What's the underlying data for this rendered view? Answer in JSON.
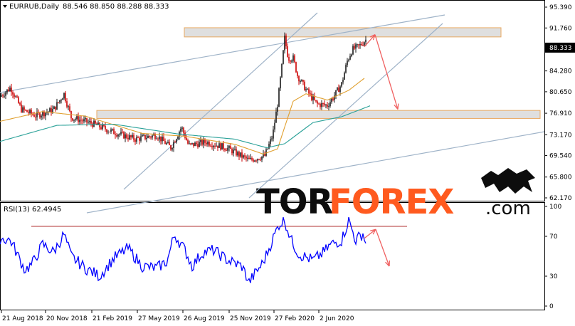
{
  "header": {
    "title": "EURRUB,Daily",
    "values": "88.546 88.850 88.288 88.333"
  },
  "rsi_header": {
    "label": "RSI(13) 62.4945"
  },
  "watermark": {
    "brand_left": "TOR",
    "brand_right": "FOREX",
    "domain": ".com"
  },
  "colors": {
    "candle_up": "#1a1a1a",
    "candle_down": "#cc0000",
    "ma_fast": "#e0a030",
    "ma_slow": "#2aa198",
    "channel": "#9fb3c8",
    "zone_fill": "#d9d9d9",
    "zone_border": "#e8a860",
    "arrow": "#f06060",
    "rsi_line": "#0000ff",
    "rsi_level": "#b03030",
    "brand_accent": "#ff5a1f"
  },
  "chart_data": [
    {
      "type": "candlestick",
      "title": "EURRUB,Daily",
      "y_ticks": [
        "95.390",
        "91.760",
        "88.333",
        "84.280",
        "80.650",
        "76.910",
        "73.170",
        "69.540",
        "65.800",
        "62.170"
      ],
      "ylim": [
        62.17,
        95.39
      ],
      "current_price": "88.333",
      "x_ticks": [
        "21 Aug 2018",
        "20 Nov 2018",
        "21 Feb 2019",
        "27 May 2019",
        "26 Aug 2019",
        "25 Nov 2019",
        "27 Feb 2020",
        "2 Jun 2020"
      ],
      "series": [
        {
          "name": "",
          "style": "candles",
          "anchors": [
            [
              0,
              79.8
            ],
            [
              15,
              81.4
            ],
            [
              30,
              77.6
            ],
            [
              50,
              76.5
            ],
            [
              75,
              77.5
            ],
            [
              90,
              80.3
            ],
            [
              100,
              76.2
            ],
            [
              130,
              75.1
            ],
            [
              160,
              73.6
            ],
            [
              190,
              72.4
            ],
            [
              220,
              73.1
            ],
            [
              240,
              70.9
            ],
            [
              255,
              74.5
            ],
            [
              265,
              71.3
            ],
            [
              290,
              71.9
            ],
            [
              320,
              70.8
            ],
            [
              350,
              68.7
            ],
            [
              372,
              69.5
            ],
            [
              383,
              73.0
            ],
            [
              390,
              78.5
            ],
            [
              396,
              85.0
            ],
            [
              400,
              90.0
            ],
            [
              405,
              86.5
            ],
            [
              412,
              86.5
            ],
            [
              418,
              83.5
            ],
            [
              430,
              81.0
            ],
            [
              445,
              78.5
            ],
            [
              460,
              78.3
            ],
            [
              470,
              80.0
            ],
            [
              480,
              82.0
            ],
            [
              488,
              86.0
            ],
            [
              495,
              88.0
            ],
            [
              505,
              88.6
            ],
            [
              514,
              89.7
            ]
          ]
        },
        {
          "name": "",
          "style": "moving-average-fast",
          "anchors": [
            [
              0,
              75.5
            ],
            [
              60,
              77.2
            ],
            [
              120,
              76.4
            ],
            [
              200,
              73.4
            ],
            [
              260,
              72.9
            ],
            [
              330,
              71.5
            ],
            [
              370,
              69.8
            ],
            [
              390,
              70.7
            ],
            [
              400,
              74.5
            ],
            [
              412,
              79.0
            ],
            [
              430,
              80.3
            ],
            [
              460,
              79.2
            ],
            [
              490,
              80.9
            ],
            [
              512,
              83.0
            ]
          ]
        },
        {
          "name": "",
          "style": "moving-average-slow",
          "anchors": [
            [
              0,
              72.0
            ],
            [
              80,
              74.8
            ],
            [
              160,
              75.0
            ],
            [
              250,
              73.3
            ],
            [
              330,
              72.4
            ],
            [
              375,
              70.9
            ],
            [
              400,
              71.6
            ],
            [
              440,
              75.3
            ],
            [
              480,
              76.3
            ],
            [
              520,
              78.2
            ]
          ]
        }
      ],
      "resistance_zone": [
        90.2,
        91.8
      ],
      "support_zone": [
        76.0,
        77.4
      ],
      "forecast_arrows": [
        [
          [
            512,
            88.5
          ],
          [
            527,
            90.6
          ]
        ],
        [
          [
            527,
            90.6
          ],
          [
            559,
            77.6
          ]
        ]
      ]
    },
    {
      "type": "line",
      "title": "RSI(13) 62.4945",
      "y_ticks": [
        "100",
        "70",
        "30",
        "0"
      ],
      "ylim": [
        0,
        100
      ],
      "level": 80,
      "series": [
        {
          "name": "",
          "anchors": [
            [
              0,
              68
            ],
            [
              15,
              66
            ],
            [
              35,
              36
            ],
            [
              45,
              42
            ],
            [
              60,
              62
            ],
            [
              75,
              54
            ],
            [
              90,
              72
            ],
            [
              100,
              50
            ],
            [
              120,
              38
            ],
            [
              140,
              30
            ],
            [
              160,
              48
            ],
            [
              180,
              58
            ],
            [
              200,
              40
            ],
            [
              220,
              38
            ],
            [
              235,
              45
            ],
            [
              245,
              72
            ],
            [
              260,
              56
            ],
            [
              270,
              40
            ],
            [
              285,
              54
            ],
            [
              300,
              56
            ],
            [
              320,
              46
            ],
            [
              340,
              40
            ],
            [
              350,
              24
            ],
            [
              370,
              44
            ],
            [
              385,
              70
            ],
            [
              392,
              82
            ],
            [
              400,
              86
            ],
            [
              410,
              65
            ],
            [
              420,
              52
            ],
            [
              440,
              46
            ],
            [
              455,
              54
            ],
            [
              465,
              62
            ],
            [
              480,
              66
            ],
            [
              490,
              86
            ],
            [
              500,
              66
            ],
            [
              510,
              73
            ],
            [
              514,
              62
            ]
          ]
        }
      ],
      "forecast_arrows": [
        [
          [
            512,
            68
          ],
          [
            528,
            77
          ]
        ],
        [
          [
            528,
            77
          ],
          [
            547,
            40
          ]
        ]
      ]
    }
  ]
}
